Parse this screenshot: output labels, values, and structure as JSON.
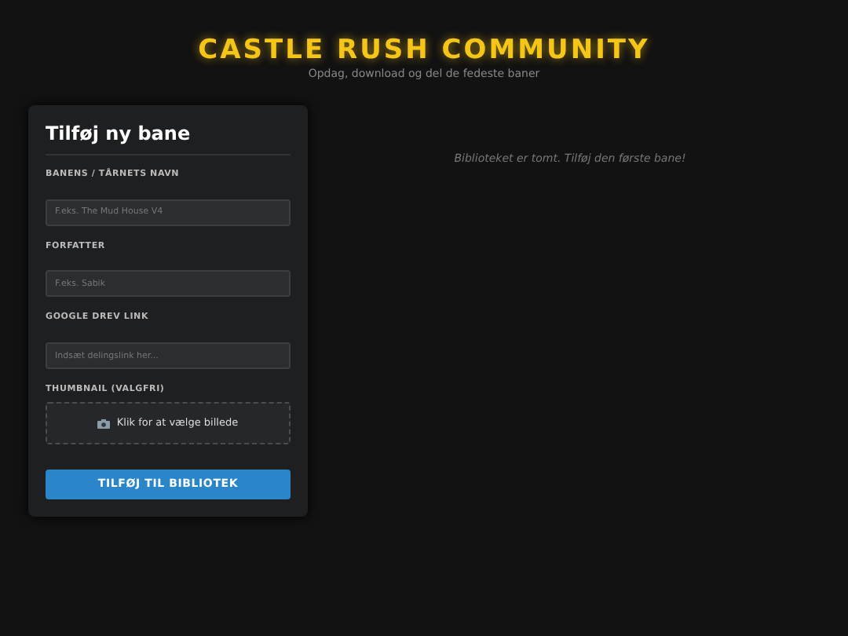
{
  "header": {
    "title": "CASTLE RUSH COMMUNITY",
    "subtitle": "Opdag, download og del de fedeste baner"
  },
  "form": {
    "title": "Tilføj ny bane",
    "fields": [
      {
        "kind": "text",
        "label": "BANENS / TÅRNETS NAVN",
        "placeholder": "F.eks. The Mud House V4"
      },
      {
        "kind": "text",
        "label": "FORFATTER",
        "placeholder": "F.eks. Sabik"
      },
      {
        "kind": "text",
        "label": "GOOGLE DREV LINK",
        "placeholder": "Indsæt delingslink her..."
      },
      {
        "kind": "upload",
        "label": "THUMBNAIL (VALGFRI)",
        "text": "Klik for at vælge billede"
      }
    ],
    "button": "TILFØJ TIL BIBLIOTEK"
  },
  "library": {
    "empty_message": "Biblioteket er tomt. Tilføj den første bane!"
  }
}
